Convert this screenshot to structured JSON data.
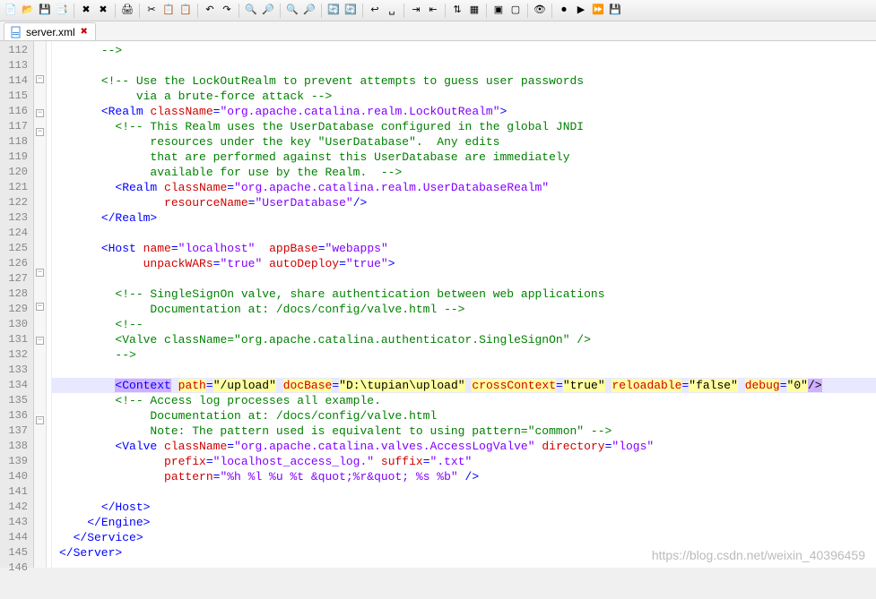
{
  "tab": {
    "filename": "server.xml"
  },
  "toolbar_icons": [
    "new",
    "open",
    "save",
    "saveall",
    "|",
    "close",
    "closeall",
    "|",
    "print",
    "|",
    "cut",
    "copy",
    "paste",
    "|",
    "undo",
    "redo",
    "|",
    "find",
    "replace",
    "|",
    "zoom-in",
    "zoom-out",
    "|",
    "sync",
    "refresh",
    "|",
    "word-wrap",
    "show-ws",
    "|",
    "indent",
    "outdent",
    "|",
    "sort",
    "cols",
    "|",
    "fold",
    "unfold",
    "|",
    "hide",
    "|",
    "macro-rec",
    "macro-play",
    "macro-fast",
    "macro-save"
  ],
  "toolbar_glyphs": [
    "📄",
    "📂",
    "💾",
    "📑",
    "|",
    "✖",
    "✖",
    "|",
    "🖨",
    "|",
    "✂",
    "📋",
    "📋",
    "|",
    "↶",
    "↷",
    "|",
    "🔍",
    "🔎",
    "|",
    "🔍",
    "🔎",
    "|",
    "🔄",
    "🔄",
    "|",
    "↩",
    "␣",
    "|",
    "⇥",
    "⇤",
    "|",
    "⇅",
    "▦",
    "|",
    "▣",
    "▢",
    "|",
    "👁",
    "|",
    "⏺",
    "▶",
    "⏩",
    "💾"
  ],
  "lines": [
    {
      "n": 112,
      "fold": "",
      "content": [
        [
          "",
          "      "
        ],
        [
          "cmt",
          "-->"
        ]
      ]
    },
    {
      "n": 113,
      "fold": "",
      "content": [
        [
          "",
          ""
        ]
      ]
    },
    {
      "n": 114,
      "fold": "m-",
      "content": [
        [
          "",
          "      "
        ],
        [
          "cmt",
          "<!-- Use the LockOutRealm to prevent attempts to guess user passwords"
        ]
      ]
    },
    {
      "n": 115,
      "fold": "",
      "content": [
        [
          "",
          "           "
        ],
        [
          "cmt",
          "via a brute-force attack -->"
        ]
      ]
    },
    {
      "n": 116,
      "fold": "m-",
      "content": [
        [
          "",
          "      "
        ],
        [
          "tag",
          "<Realm"
        ],
        [
          "",
          " "
        ],
        [
          "attr",
          "className"
        ],
        [
          "tag",
          "="
        ],
        [
          "val",
          "\"org.apache.catalina.realm.LockOutRealm\""
        ],
        [
          "tag",
          ">"
        ]
      ]
    },
    {
      "n": 117,
      "fold": "m-",
      "content": [
        [
          "",
          "        "
        ],
        [
          "cmt",
          "<!-- This Realm uses the UserDatabase configured in the global JNDI"
        ]
      ]
    },
    {
      "n": 118,
      "fold": "",
      "content": [
        [
          "",
          "             "
        ],
        [
          "cmt",
          "resources under the key \"UserDatabase\".  Any edits"
        ]
      ]
    },
    {
      "n": 119,
      "fold": "",
      "content": [
        [
          "",
          "             "
        ],
        [
          "cmt",
          "that are performed against this UserDatabase are immediately"
        ]
      ]
    },
    {
      "n": 120,
      "fold": "",
      "content": [
        [
          "",
          "             "
        ],
        [
          "cmt",
          "available for use by the Realm.  -->"
        ]
      ]
    },
    {
      "n": 121,
      "fold": "",
      "content": [
        [
          "",
          "        "
        ],
        [
          "tag",
          "<Realm"
        ],
        [
          "",
          " "
        ],
        [
          "attr",
          "className"
        ],
        [
          "tag",
          "="
        ],
        [
          "val",
          "\"org.apache.catalina.realm.UserDatabaseRealm\""
        ]
      ]
    },
    {
      "n": 122,
      "fold": "",
      "content": [
        [
          "",
          "               "
        ],
        [
          "attr",
          "resourceName"
        ],
        [
          "tag",
          "="
        ],
        [
          "val",
          "\"UserDatabase\""
        ],
        [
          "tag",
          "/>"
        ]
      ]
    },
    {
      "n": 123,
      "fold": "",
      "content": [
        [
          "",
          "      "
        ],
        [
          "tag",
          "</Realm>"
        ]
      ]
    },
    {
      "n": 124,
      "fold": "",
      "content": [
        [
          "",
          ""
        ]
      ]
    },
    {
      "n": 125,
      "fold": "",
      "content": [
        [
          "",
          "      "
        ],
        [
          "tag",
          "<Host"
        ],
        [
          "",
          " "
        ],
        [
          "attr",
          "name"
        ],
        [
          "tag",
          "="
        ],
        [
          "val",
          "\"localhost\""
        ],
        [
          "",
          "  "
        ],
        [
          "attr",
          "appBase"
        ],
        [
          "tag",
          "="
        ],
        [
          "val",
          "\"webapps\""
        ]
      ]
    },
    {
      "n": 126,
      "fold": "m-",
      "content": [
        [
          "",
          "            "
        ],
        [
          "attr",
          "unpackWARs"
        ],
        [
          "tag",
          "="
        ],
        [
          "val",
          "\"true\""
        ],
        [
          "",
          " "
        ],
        [
          "attr",
          "autoDeploy"
        ],
        [
          "tag",
          "="
        ],
        [
          "val",
          "\"true\""
        ],
        [
          "tag",
          ">"
        ]
      ]
    },
    {
      "n": 127,
      "fold": "",
      "content": [
        [
          "",
          ""
        ]
      ]
    },
    {
      "n": 128,
      "fold": "m-",
      "content": [
        [
          "",
          "        "
        ],
        [
          "cmt",
          "<!-- SingleSignOn valve, share authentication between web applications"
        ]
      ]
    },
    {
      "n": 129,
      "fold": "",
      "content": [
        [
          "",
          "             "
        ],
        [
          "cmt",
          "Documentation at: /docs/config/valve.html -->"
        ]
      ]
    },
    {
      "n": 130,
      "fold": "m-",
      "content": [
        [
          "",
          "        "
        ],
        [
          "cmt",
          "<!--"
        ]
      ]
    },
    {
      "n": 131,
      "fold": "",
      "content": [
        [
          "",
          "        "
        ],
        [
          "cmt",
          "<Valve className=\"org.apache.catalina.authenticator.SingleSignOn\" />"
        ]
      ]
    },
    {
      "n": 132,
      "fold": "",
      "content": [
        [
          "",
          "        "
        ],
        [
          "cmt",
          "-->"
        ]
      ]
    },
    {
      "n": 133,
      "fold": "",
      "content": [
        [
          "",
          ""
        ]
      ]
    },
    {
      "n": 134,
      "fold": "",
      "hl": true,
      "content": [
        [
          "",
          "        "
        ],
        [
          "sel-tag",
          "<Context"
        ],
        [
          "",
          " "
        ],
        [
          "sel-attrname",
          "path"
        ],
        [
          "tag",
          "="
        ],
        [
          "sel-attr",
          "\"/upload\""
        ],
        [
          "",
          " "
        ],
        [
          "sel-attrname",
          "docBase"
        ],
        [
          "tag",
          "="
        ],
        [
          "sel-attr",
          "\"D:\\tupian\\upload\""
        ],
        [
          "",
          " "
        ],
        [
          "sel-attrname",
          "crossContext"
        ],
        [
          "tag",
          "="
        ],
        [
          "sel-attr",
          "\"true\""
        ],
        [
          "",
          " "
        ],
        [
          "sel-attrname",
          "reloadable"
        ],
        [
          "tag",
          "="
        ],
        [
          "sel-attr",
          "\"false\""
        ],
        [
          "",
          " "
        ],
        [
          "sel-attrname",
          "debug"
        ],
        [
          "tag",
          "="
        ],
        [
          "sel-attr",
          "\"0\""
        ],
        [
          "sel-close",
          "/>"
        ]
      ]
    },
    {
      "n": 135,
      "fold": "m-",
      "content": [
        [
          "",
          "        "
        ],
        [
          "cmt",
          "<!-- Access log processes all example."
        ]
      ]
    },
    {
      "n": 136,
      "fold": "",
      "content": [
        [
          "",
          "             "
        ],
        [
          "cmt",
          "Documentation at: /docs/config/valve.html"
        ]
      ]
    },
    {
      "n": 137,
      "fold": "",
      "content": [
        [
          "",
          "             "
        ],
        [
          "cmt",
          "Note: The pattern used is equivalent to using pattern=\"common\" -->"
        ]
      ]
    },
    {
      "n": 138,
      "fold": "",
      "content": [
        [
          "",
          "        "
        ],
        [
          "tag",
          "<Valve"
        ],
        [
          "",
          " "
        ],
        [
          "attr",
          "className"
        ],
        [
          "tag",
          "="
        ],
        [
          "val",
          "\"org.apache.catalina.valves.AccessLogValve\""
        ],
        [
          "",
          " "
        ],
        [
          "attr",
          "directory"
        ],
        [
          "tag",
          "="
        ],
        [
          "val",
          "\"logs\""
        ]
      ]
    },
    {
      "n": 139,
      "fold": "",
      "content": [
        [
          "",
          "               "
        ],
        [
          "attr",
          "prefix"
        ],
        [
          "tag",
          "="
        ],
        [
          "val",
          "\"localhost_access_log.\""
        ],
        [
          "",
          " "
        ],
        [
          "attr",
          "suffix"
        ],
        [
          "tag",
          "="
        ],
        [
          "val",
          "\".txt\""
        ]
      ]
    },
    {
      "n": 140,
      "fold": "",
      "content": [
        [
          "",
          "               "
        ],
        [
          "attr",
          "pattern"
        ],
        [
          "tag",
          "="
        ],
        [
          "val",
          "\"%h %l %u %t &quot;%r&quot; %s %b\""
        ],
        [
          "",
          " "
        ],
        [
          "tag",
          "/>"
        ]
      ]
    },
    {
      "n": 141,
      "fold": "",
      "content": [
        [
          "",
          ""
        ]
      ]
    },
    {
      "n": 142,
      "fold": "",
      "content": [
        [
          "",
          "      "
        ],
        [
          "tag",
          "</Host>"
        ]
      ]
    },
    {
      "n": 143,
      "fold": "",
      "content": [
        [
          "",
          "    "
        ],
        [
          "tag",
          "</Engine>"
        ]
      ]
    },
    {
      "n": 144,
      "fold": "",
      "content": [
        [
          "",
          "  "
        ],
        [
          "tag",
          "</Service>"
        ]
      ]
    },
    {
      "n": 145,
      "fold": "",
      "content": [
        [
          "tag",
          "</Server>"
        ]
      ]
    },
    {
      "n": 146,
      "fold": "",
      "content": [
        [
          "",
          ""
        ]
      ]
    }
  ],
  "watermark": "https://blog.csdn.net/weixin_40396459"
}
